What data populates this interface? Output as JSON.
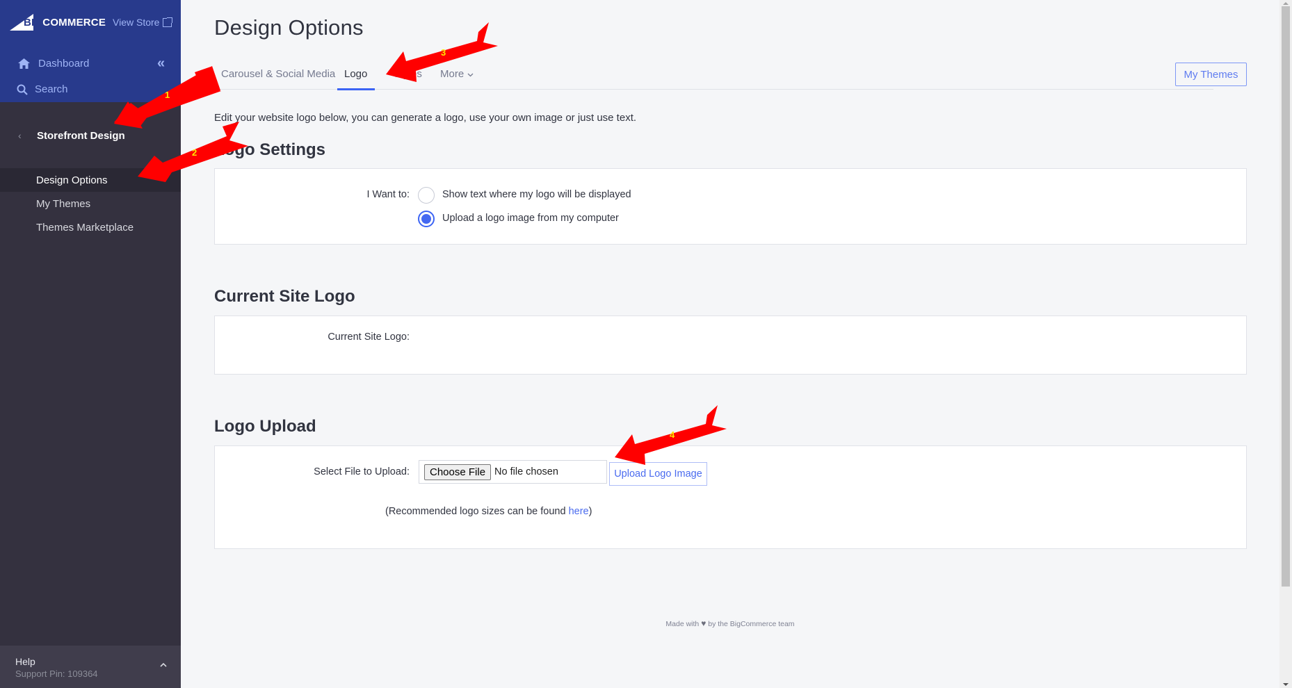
{
  "sidebar": {
    "brand": "BIGCOMMERCE",
    "brand_prefix": "BIG",
    "brand_suffix": "COMMERCE",
    "view_store": "View Store",
    "nav": [
      {
        "label": "Dashboard",
        "icon": "home-icon"
      },
      {
        "label": "Search",
        "icon": "search-icon"
      }
    ],
    "collapse_icon": "«",
    "section": {
      "back_icon": "‹",
      "title": "Storefront Design"
    },
    "sub_items": [
      {
        "label": "Design Options",
        "active": true
      },
      {
        "label": "My Themes",
        "active": false
      },
      {
        "label": "Themes Marketplace",
        "active": false
      }
    ],
    "help": {
      "label": "Help",
      "support_pin": "Support Pin: 109364",
      "chevron": "^"
    }
  },
  "main": {
    "title": "Design Options",
    "tabs": [
      {
        "label": "Carousel & Social Media",
        "active": false
      },
      {
        "label": "Logo",
        "active": true
      },
      {
        "label": "Styles",
        "active": false
      },
      {
        "label": "More",
        "active": false
      }
    ],
    "more_chevron": "⌄",
    "my_themes_button": "My Themes",
    "intro": "Edit your website logo below, you can generate a logo, use your own image or just use text.",
    "logo_settings": {
      "heading": "Logo Settings",
      "label": "I Want to:",
      "options": [
        {
          "label": "Show text where my logo will be displayed",
          "checked": false
        },
        {
          "label": "Upload a logo image from my computer",
          "checked": true
        }
      ]
    },
    "current_logo": {
      "heading": "Current Site Logo",
      "label": "Current Site Logo:"
    },
    "logo_upload": {
      "heading": "Logo Upload",
      "label": "Select File to Upload:",
      "choose_file": "Choose File",
      "file_status": "No file chosen",
      "upload_button": "Upload Logo Image",
      "recommend_prefix": "(Recommended logo sizes can be found ",
      "recommend_link": "here",
      "recommend_suffix": ")"
    },
    "footer": {
      "prefix": "Made with",
      "heart": "♥",
      "suffix": "by the BigCommerce team"
    }
  },
  "annotations": {
    "color": "#ff0000",
    "number_color": "#ffe800",
    "arrows": [
      {
        "number": "1",
        "target": "Storefront Design"
      },
      {
        "number": "2",
        "target": "Design Options"
      },
      {
        "number": "3",
        "target": "Styles tab"
      },
      {
        "number": "4",
        "target": "Upload Logo Image"
      }
    ]
  },
  "colors": {
    "sidebar_top": "#283a8c",
    "sidebar": "#34313f",
    "accent": "#3c64f4",
    "link": "#4a6bef",
    "background": "#f5f6f8"
  }
}
